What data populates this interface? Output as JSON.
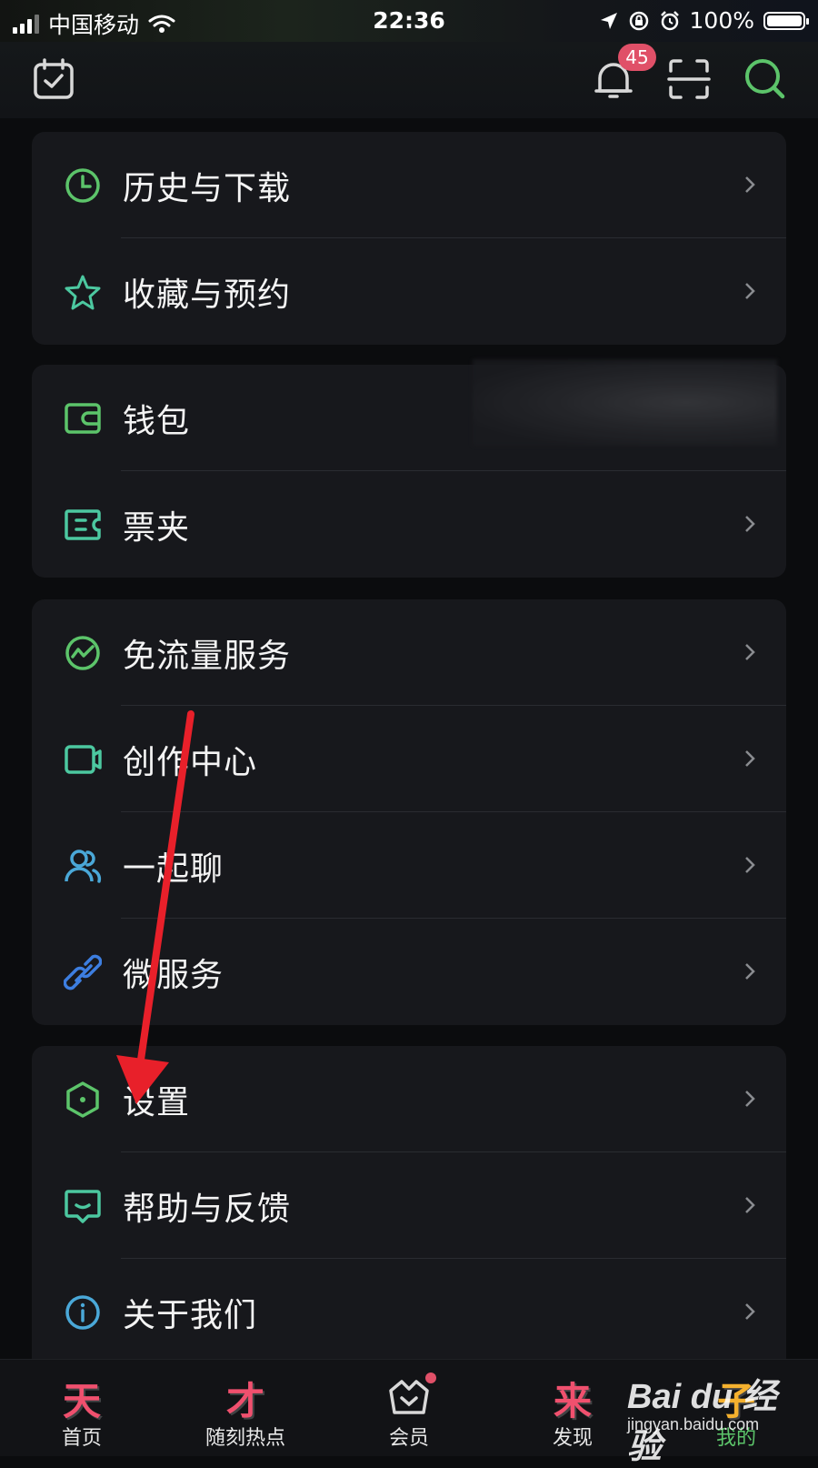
{
  "status_bar": {
    "carrier": "中国移动",
    "time": "22:36",
    "battery": "100%"
  },
  "header": {
    "notification_count": "45",
    "icons": [
      "calendar-check-icon",
      "bell-icon",
      "scan-icon",
      "search-icon"
    ]
  },
  "menu_groups": [
    {
      "items": [
        {
          "label": "历史与下载",
          "icon": "clock-icon"
        },
        {
          "label": "收藏与预约",
          "icon": "star-icon"
        }
      ]
    },
    {
      "items": [
        {
          "label": "钱包",
          "icon": "wallet-icon"
        },
        {
          "label": "票夹",
          "icon": "ticket-icon"
        }
      ]
    },
    {
      "items": [
        {
          "label": "免流量服务",
          "icon": "data-free-icon"
        },
        {
          "label": "创作中心",
          "icon": "video-camera-icon"
        },
        {
          "label": "一起聊",
          "icon": "group-chat-icon"
        },
        {
          "label": "微服务",
          "icon": "link-icon"
        }
      ]
    },
    {
      "items": [
        {
          "label": "设置",
          "icon": "settings-hexagon-icon"
        },
        {
          "label": "帮助与反馈",
          "icon": "feedback-icon"
        },
        {
          "label": "关于我们",
          "icon": "info-icon"
        }
      ]
    }
  ],
  "tab_bar": {
    "tabs": [
      {
        "label": "首页",
        "glyph": "天"
      },
      {
        "label": "随刻热点",
        "glyph": "才"
      },
      {
        "label": "会员",
        "glyph": ""
      },
      {
        "label": "发现",
        "glyph": "来"
      },
      {
        "label": "我的",
        "glyph": "子"
      }
    ],
    "active_tab": "我的"
  },
  "watermark": {
    "brand": "Bai du 经验",
    "url": "jingyan.baidu.com"
  },
  "colors": {
    "accent_green": "#5cc46a",
    "badge_red": "#e05068",
    "annotation_arrow": "#e8202a"
  }
}
